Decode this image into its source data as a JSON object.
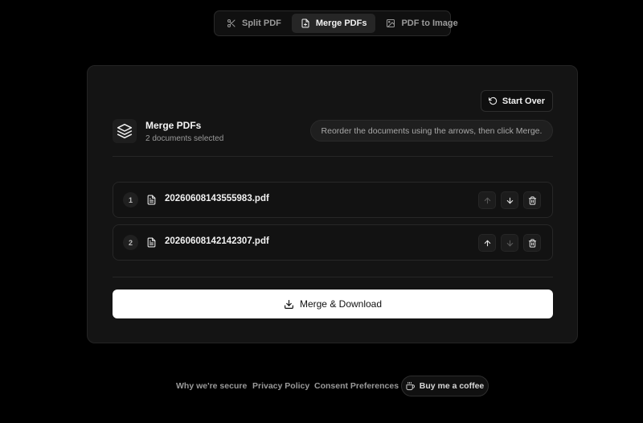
{
  "tabs": [
    {
      "label": "Split PDF",
      "icon": "scissors-icon",
      "active": false
    },
    {
      "label": "Merge PDFs",
      "icon": "file-plus-icon",
      "active": true
    },
    {
      "label": "PDF to Image",
      "icon": "image-icon",
      "active": false
    }
  ],
  "card": {
    "start_over_label": "Start Over",
    "title": "Merge PDFs",
    "subtitle": "2 documents selected",
    "hint": "Reorder the documents using the arrows, then click Merge.",
    "files": [
      {
        "index": "1",
        "name": "20260608143555983.pdf",
        "up_disabled": true,
        "down_disabled": false
      },
      {
        "index": "2",
        "name": "20260608142142307.pdf",
        "up_disabled": false,
        "down_disabled": true
      }
    ],
    "merge_label": "Merge & Download"
  },
  "footer": {
    "links": [
      "Why we're secure",
      "Privacy Policy",
      "Consent Preferences"
    ],
    "coffee_label": "Buy me a coffee"
  },
  "colors": {
    "background": "#000000",
    "card": "#141414",
    "primary_button": "#ffffff"
  }
}
